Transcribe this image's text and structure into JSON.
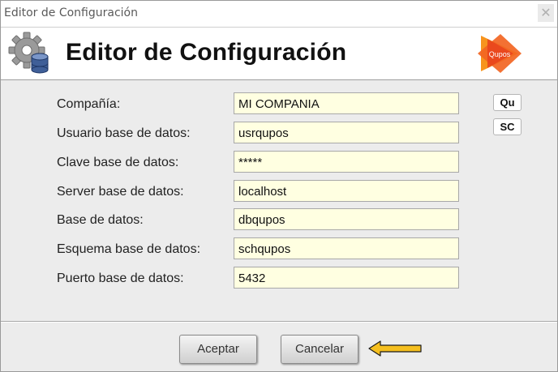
{
  "window": {
    "title": "Editor de Configuración",
    "close_glyph": "✕"
  },
  "header": {
    "heading": "Editor de Configuración",
    "left_icon": "gear-database-icon",
    "right_logo_text": "Qupos"
  },
  "form": {
    "fields": [
      {
        "label": "Compañía:",
        "value": "MI COMPANIA"
      },
      {
        "label": "Usuario base de datos:",
        "value": "usrqupos"
      },
      {
        "label": "Clave base de datos:",
        "value": "*****"
      },
      {
        "label": "Server base de datos:",
        "value": "localhost"
      },
      {
        "label": "Base de datos:",
        "value": "dbqupos"
      },
      {
        "label": "Esquema base de datos:",
        "value": "schqupos"
      },
      {
        "label": "Puerto base de datos:",
        "value": "5432"
      }
    ],
    "side_buttons": [
      "Qu",
      "SC"
    ]
  },
  "footer": {
    "accept_label": "Aceptar",
    "cancel_label": "Cancelar"
  },
  "colors": {
    "input_bg": "#ffffe1",
    "window_bg": "#ececec",
    "logo_orange": "#f26522",
    "arrow_yellow": "#f5bf1f"
  }
}
